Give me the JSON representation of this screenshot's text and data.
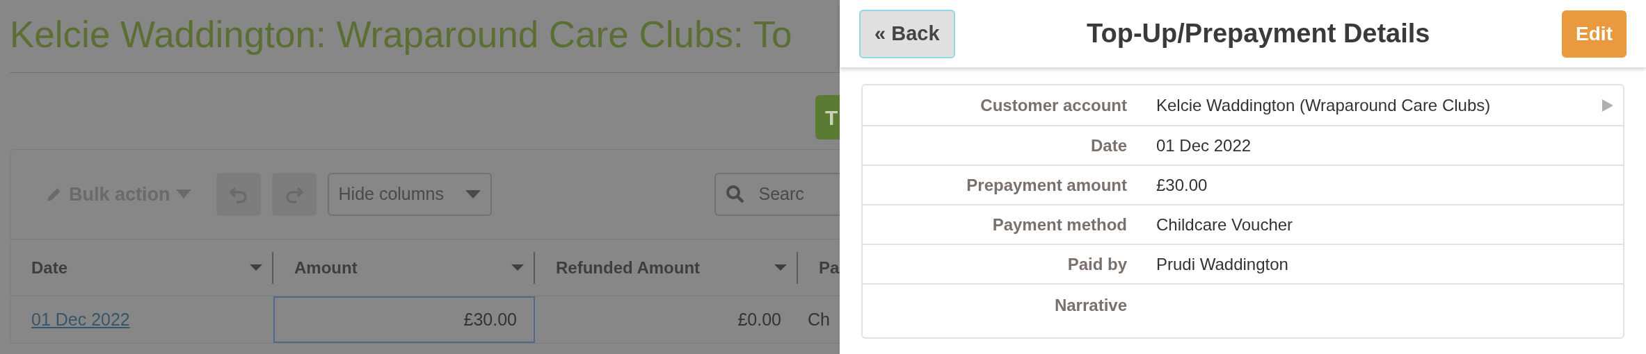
{
  "page": {
    "title": "Kelcie Waddington: Wraparound Care Clubs: To",
    "primary_button": "T",
    "toolbar": {
      "bulk_action": "Bulk action",
      "hide_columns": "Hide columns",
      "search_placeholder": "Searc"
    },
    "table": {
      "columns": [
        "Date",
        "Amount",
        "Refunded Amount",
        "Pa"
      ],
      "rows": [
        {
          "cells": [
            "01 Dec 2022",
            "£30.00",
            "£0.00",
            "Ch"
          ]
        }
      ]
    }
  },
  "panel": {
    "back": "« Back",
    "title": "Top-Up/Prepayment Details",
    "edit": "Edit",
    "fields": [
      {
        "label": "Customer account",
        "value": "Kelcie Waddington (Wraparound Care Clubs)",
        "kind": "link"
      },
      {
        "label": "Date",
        "value": "01 Dec 2022",
        "kind": "text"
      },
      {
        "label": "Prepayment amount",
        "value": "£30.00",
        "kind": "text"
      },
      {
        "label": "Payment method",
        "value": "Childcare Voucher",
        "kind": "text"
      },
      {
        "label": "Paid by",
        "value": "Prudi Waddington",
        "kind": "text"
      },
      {
        "label": "Narrative",
        "kind": "text"
      }
    ]
  }
}
